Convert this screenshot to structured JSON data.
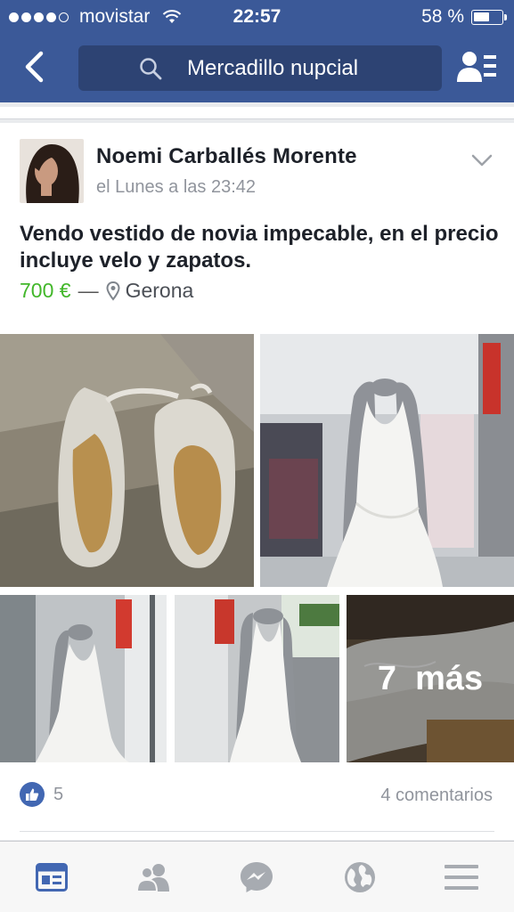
{
  "status_bar": {
    "carrier": "movistar",
    "time": "22:57",
    "battery_text": "58 %",
    "battery_level": 0.58
  },
  "header": {
    "search_text": "Mercadillo nupcial",
    "icons": [
      "back-icon",
      "search-icon",
      "group-members-icon"
    ]
  },
  "post": {
    "author": "Noemi Carballés Morente",
    "timestamp": "el Lunes a las 23:42",
    "text": "Vendo vestido de novia impecable, en el precio incluye velo y zapatos.",
    "price": "700 €",
    "separator": "—",
    "location": "Gerona",
    "more_photos_label": "7  más",
    "like_count": "5",
    "comments": "4 comentarios"
  },
  "tabbar": {
    "tabs": [
      "news-feed-icon",
      "friends-icon",
      "messenger-icon",
      "globe-notifications-icon",
      "menu-icon"
    ]
  },
  "colors": {
    "brand": "#3b5998",
    "price": "#42b72a",
    "active_tab": "#4267b2"
  }
}
